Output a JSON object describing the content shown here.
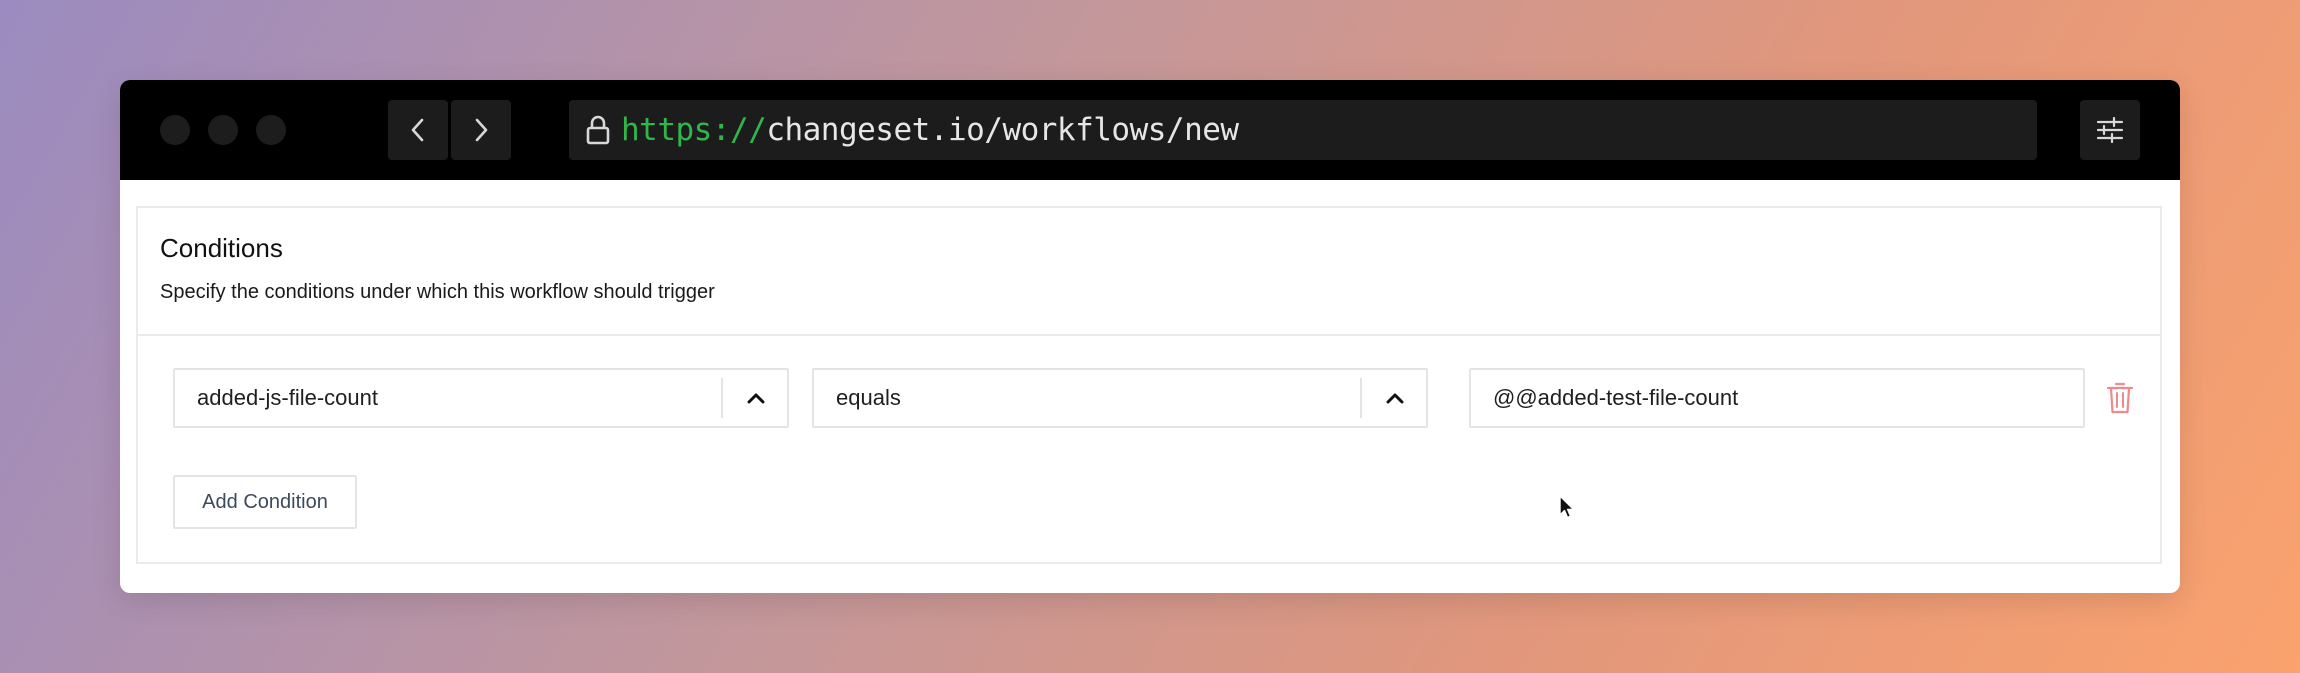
{
  "browser": {
    "url_scheme": "https://",
    "url_rest": "changeset.io/workflows/new",
    "back_icon": "chevron-left-icon",
    "forward_icon": "chevron-right-icon",
    "lock_icon": "lock-icon",
    "settings_icon": "sliders-icon"
  },
  "conditions": {
    "title": "Conditions",
    "description": "Specify the conditions under which this workflow should trigger",
    "rows": [
      {
        "field": "added-js-file-count",
        "operator": "equals",
        "value": "@@added-test-file-count"
      }
    ],
    "add_label": "Add Condition"
  },
  "colors": {
    "url_scheme": "#2fb84a",
    "delete_icon": "#f08a8a",
    "add_button_text": "#3c4a5e"
  }
}
